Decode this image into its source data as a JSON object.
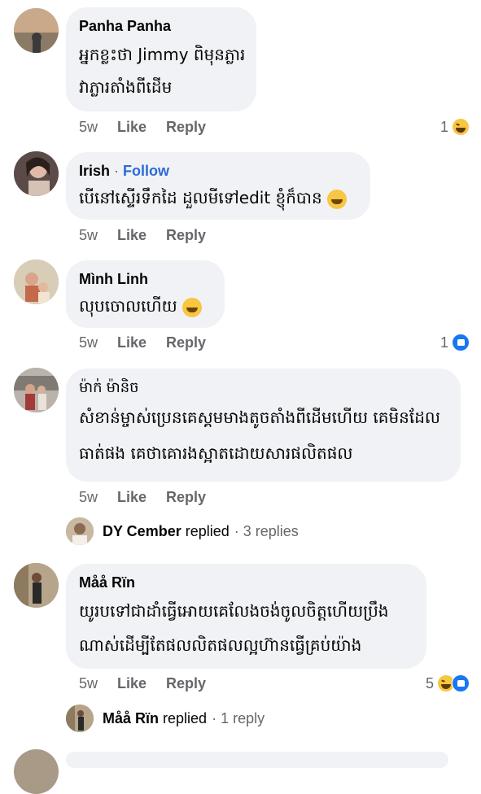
{
  "comments": [
    {
      "author": "Panha Panha",
      "lines": [
        "អ្នកខ្លះថា Jimmy ពិមុនភ្លារ",
        "វាភ្លារតាំងពីដើម"
      ],
      "time": "5w",
      "like": "Like",
      "reply": "Reply",
      "reaction_count": "1",
      "reactions": [
        "haha-emoji"
      ]
    },
    {
      "author": "Irish",
      "follow": "Follow",
      "lines": [
        "បើនៅស្ទើរទឹកដៃ ដួលមីទៅedit ខ្ញុំក៏បាន"
      ],
      "time": "5w",
      "like": "Like",
      "reply": "Reply"
    },
    {
      "author": "Mình Linh",
      "lines": [
        "លុបចោលហើយ"
      ],
      "time": "5w",
      "like": "Like",
      "reply": "Reply",
      "reaction_count": "1",
      "reactions": [
        "like-emoji"
      ]
    },
    {
      "author": "ម៉ាក់ ម៉ានិច",
      "lines": [
        "សំខាន់ម្ចាស់ប្រេនគេស្គមមាងតូចតាំងពីដើមហើយ គេមិនដែល",
        "ធាត់ផង គេថាគោរងស្អាតដោយសារផលិតផល"
      ],
      "time": "5w",
      "like": "Like",
      "reply": "Reply",
      "replies": {
        "who": "DY Cember",
        "verb": "replied",
        "count": "3 replies"
      }
    },
    {
      "author": "Måå Rïn",
      "lines": [
        "យូរបទៅជាដាំធ្វើអោយគេលែងចង់ចូលចិត្តហើយប្រឹង",
        "ណាស់ដើម្បីតែផលលិតផលល្អហ៊ានធ្វើគ្រប់យ៉ាង"
      ],
      "time": "5w",
      "like": "Like",
      "reply": "Reply",
      "reaction_count": "5",
      "reactions": [
        "haha-emoji",
        "like-emoji"
      ],
      "replies": {
        "who": "Måå Rïn",
        "verb": "replied",
        "count": "1 reply"
      }
    }
  ],
  "separator": "·"
}
